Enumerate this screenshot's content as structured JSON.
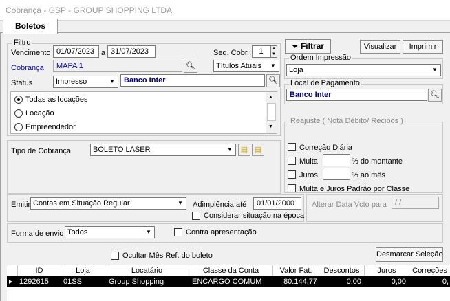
{
  "window": {
    "title": "Cobrança - GSP - GROUP SHOPPING LTDA"
  },
  "tabs": [
    {
      "label": "Boletos"
    }
  ],
  "filtro": {
    "legend": "Filtro",
    "vencimento_label": "Vencimento",
    "date_from": "01/07/2023",
    "date_sep": "a",
    "date_to": "31/07/2023",
    "seq_label": "Seq. Cobr.:",
    "seq_value": "1",
    "cobranca_label": "Cobrança",
    "cobranca_value": "MAPA 1",
    "titulos_value": "Títulos Atuais",
    "status_label": "Status",
    "status_value": "Impresso",
    "banco_value": "Banco Inter",
    "locacoes": [
      {
        "label": "Todas as locações",
        "selected": true
      },
      {
        "label": "Locação",
        "selected": false
      },
      {
        "label": "Empreendedor",
        "selected": false
      }
    ]
  },
  "buttons": {
    "filtrar": "Filtrar",
    "visualizar": "Visualizar",
    "imprimir": "Imprimir",
    "desmarcar": "Desmarcar Seleção"
  },
  "ordem": {
    "legend": "Ordem Impressão",
    "value": "Loja"
  },
  "local": {
    "legend": "Local de Pagamento",
    "value": "Banco Inter"
  },
  "reajuste": {
    "legend": "Reajuste ( Nota Débito/ Recibos )",
    "correcao": "Correção Diária",
    "multa": "Multa",
    "multa_suffix": "% do montante",
    "juros": "Juros",
    "juros_suffix": "% ao mês",
    "padrao": "Multa e Juros Padrão por Classe"
  },
  "tipo": {
    "label": "Tipo de Cobrança",
    "value": "BOLETO LASER"
  },
  "emitir": {
    "label": "Emitir",
    "value": "Contas em Situação Regular",
    "adimplencia_label": "Adimplência até",
    "adimplencia_value": "01/01/2000",
    "considerar": "Considerar situação na época",
    "alterar_label": "Alterar Data Vcto para",
    "alterar_value": " / /"
  },
  "envio": {
    "label": "Forma de envio",
    "value": "Todos",
    "contra": "Contra apresentação"
  },
  "ocultar": "Ocultar Mês Ref. do boleto",
  "table": {
    "columns": [
      "ID",
      "Loja",
      "Locatário",
      "Classe da Conta",
      "Valor Fat.",
      "Descontos",
      "Juros",
      "Correções"
    ],
    "rows": [
      [
        "1292615",
        "01SS",
        "Group Shopping",
        "ENCARGO COMUM",
        "80.144,77",
        "0,00",
        "0,00",
        "0,"
      ]
    ]
  }
}
